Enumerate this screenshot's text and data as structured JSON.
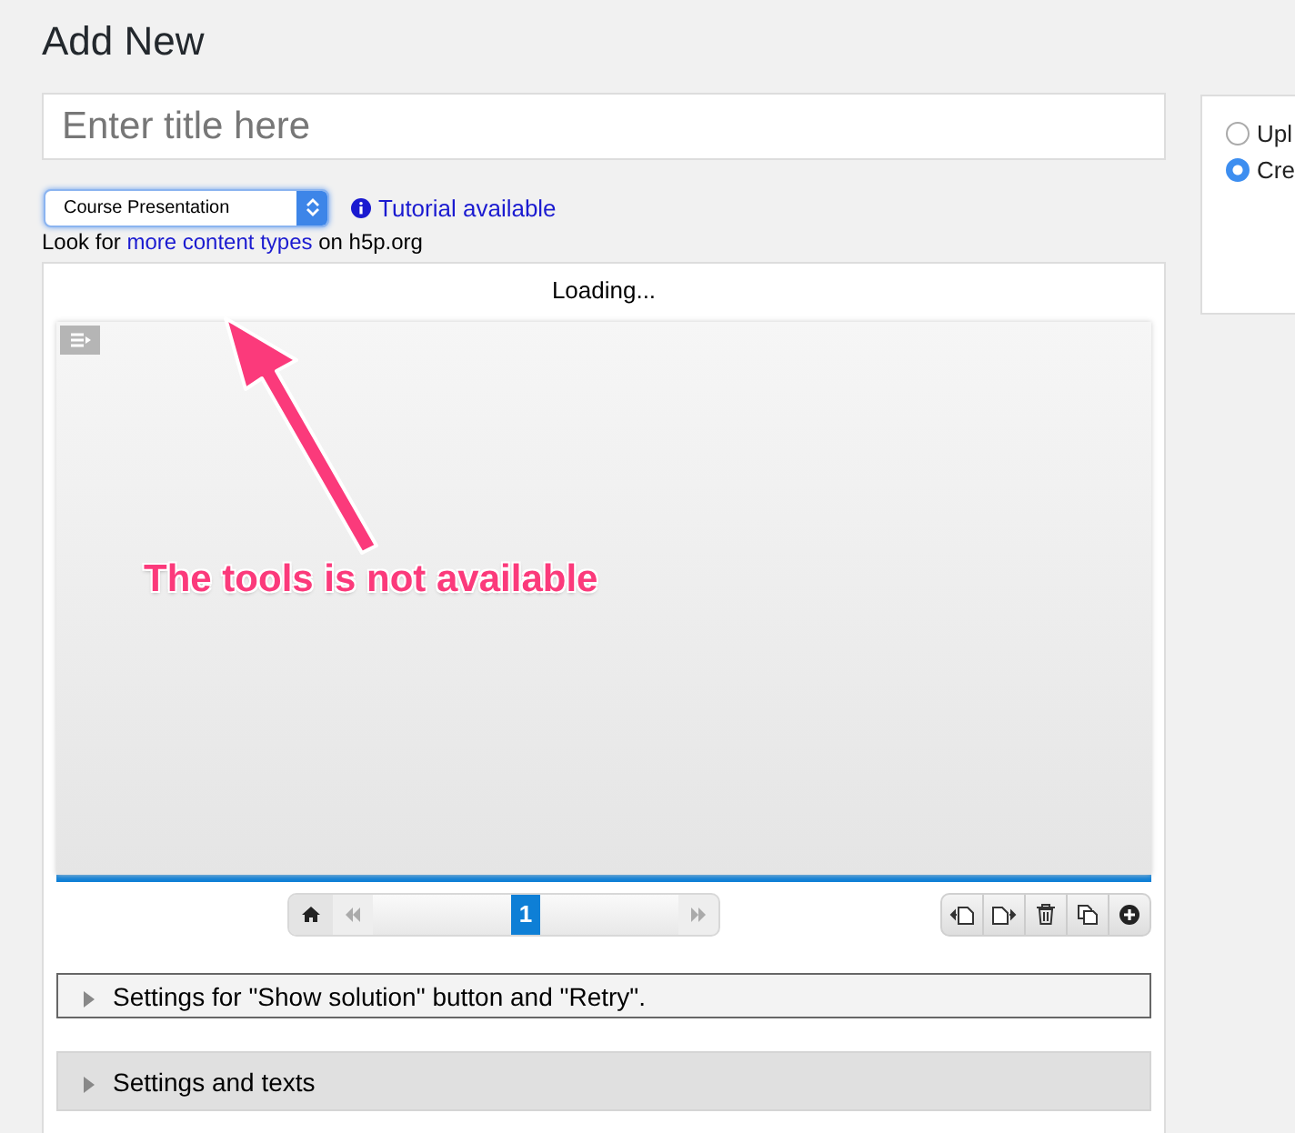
{
  "page_title": "Add New",
  "title_field": {
    "placeholder": "Enter title here"
  },
  "content_type_select": {
    "value": "Course Presentation"
  },
  "tutorial_link": "Tutorial available",
  "hint": {
    "before": "Look for",
    "link": "more content types",
    "after": "on h5p.org"
  },
  "editor": {
    "status": "Loading...",
    "current_slide": "1",
    "progress": {
      "level": 1
    }
  },
  "annotation": {
    "text": "The tools is not available"
  },
  "sections": [
    {
      "label": "Settings for \"Show solution\" button and \"Retry\".",
      "focused": true
    },
    {
      "label": "Settings and texts",
      "focused": false
    }
  ],
  "side_panel": {
    "options": [
      {
        "label": "Upl",
        "selected": false
      },
      {
        "label": "Cre",
        "selected": true
      }
    ]
  }
}
